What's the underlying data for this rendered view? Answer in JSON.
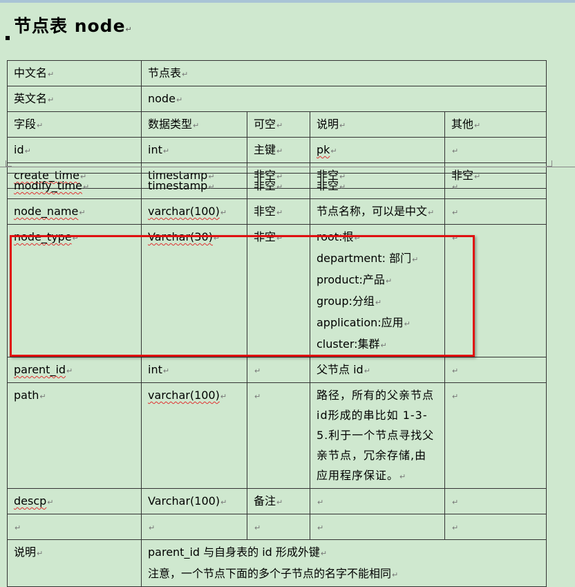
{
  "title": "节点表 node",
  "info": {
    "cn_label": "中文名",
    "cn_value": "节点表",
    "en_label": "英文名",
    "en_value": "node"
  },
  "headers": [
    "字段",
    "数据类型",
    "可空",
    "说明",
    "其他"
  ],
  "rows_top": [
    [
      "id",
      "int",
      "主键",
      "pk",
      ""
    ],
    [
      "create_time",
      "timestamp",
      "非空",
      "非空",
      "非空"
    ]
  ],
  "rows": [
    [
      "modify_time",
      "timestamp",
      "非空",
      "非空",
      ""
    ],
    [
      "node_name",
      "varchar(100)",
      "非空",
      "节点名称，可以是中文",
      ""
    ],
    [
      "node_type",
      "Varchar(30)",
      "非空",
      [
        "root:根",
        "department:  部门",
        "product:产品",
        "group:分组",
        "application:应用",
        "cluster:集群"
      ],
      ""
    ],
    [
      "parent_id",
      "int",
      "",
      "父节点 id",
      ""
    ],
    [
      "path",
      "varchar(100)",
      "",
      "路径，所有的父亲节点id形成的串比如 1-3-5.利于一个节点寻找父亲节点，冗余存储,由应用程序保证。",
      ""
    ],
    [
      "descp",
      "Varchar(100)",
      "备注",
      "",
      ""
    ],
    [
      "",
      "",
      "",
      "",
      ""
    ]
  ],
  "notes": {
    "label": "说明",
    "line1": "parent_id  与自身表的 id 形成外键",
    "line2": "注意，一个节点下面的多个子节点的名字不能相同"
  },
  "colors": {
    "background": "#cfe8cf",
    "highlight": "#e01010"
  }
}
